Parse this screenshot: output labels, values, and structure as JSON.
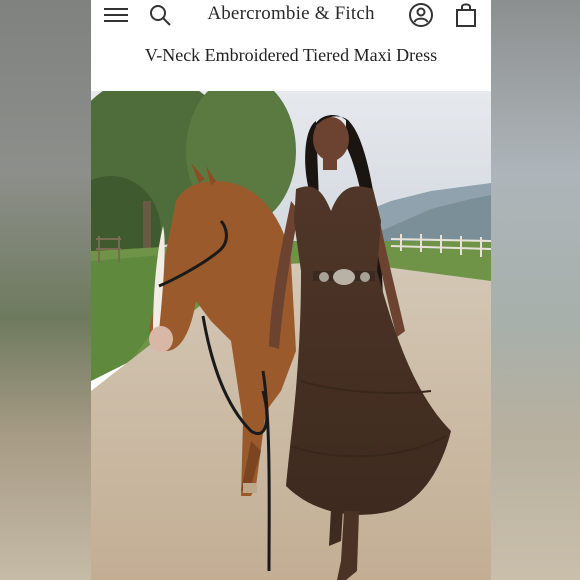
{
  "header": {
    "brand": "Abercrombie & Fitch",
    "menu_icon": "hamburger-menu-icon",
    "search_icon": "search-icon",
    "account_icon": "account-icon",
    "bag_icon": "shopping-bag-icon"
  },
  "product": {
    "title": "V-Neck Embroidered Tiered Maxi Dress"
  },
  "colors": {
    "dress": "#4a3226",
    "sky": "#dfe3e8",
    "road": "#cbbba4",
    "grass": "#6b8f48",
    "horse": "#9a5a2e"
  }
}
